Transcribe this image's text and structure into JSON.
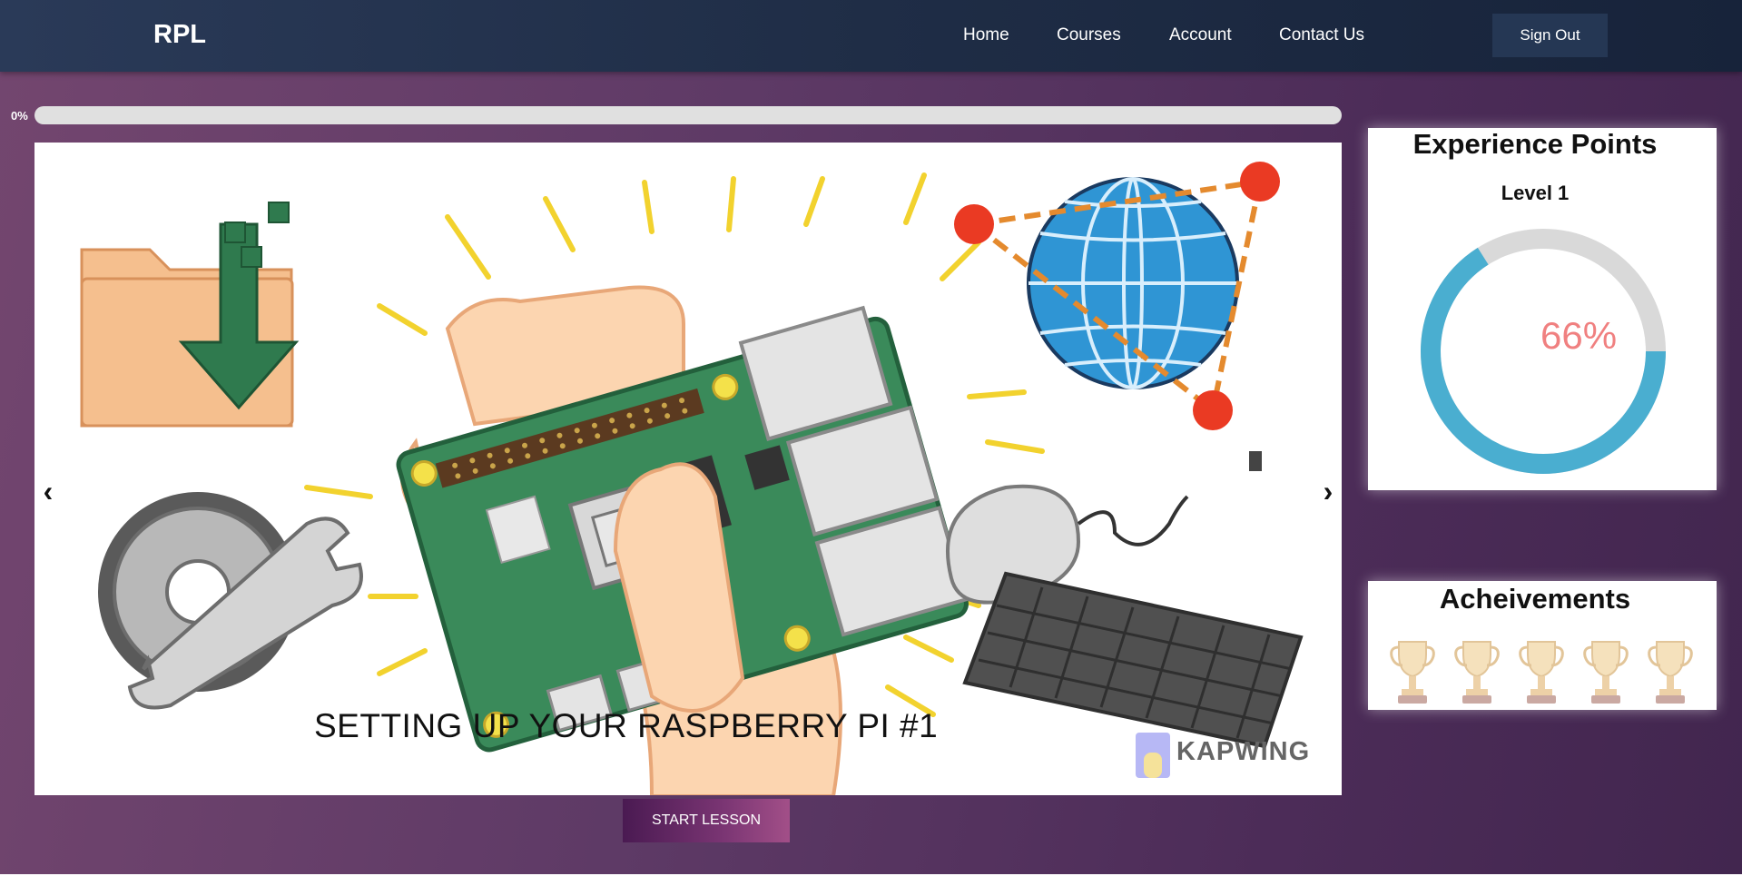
{
  "navbar": {
    "brand": "RPL",
    "links": [
      "Home",
      "Courses",
      "Account",
      "Contact Us"
    ],
    "sign_out": "Sign Out"
  },
  "progress": {
    "label": "0%",
    "value": 0
  },
  "slide": {
    "title": "SETTING UP YOUR RASPBERRY PI #1",
    "watermark": "KAPWING",
    "prev_icon": "chevron-left-icon",
    "next_icon": "chevron-right-icon"
  },
  "start_lesson": "START LESSON",
  "xp": {
    "title": "Experience Points",
    "level": "Level 1",
    "percent_label": "66%",
    "percent": 66,
    "colors": {
      "ring": "#4aaed0",
      "track": "#d9d9d9",
      "text": "#f08080"
    }
  },
  "achievements": {
    "title": "Acheivements",
    "trophy_count": 5,
    "icon": "trophy-icon"
  }
}
